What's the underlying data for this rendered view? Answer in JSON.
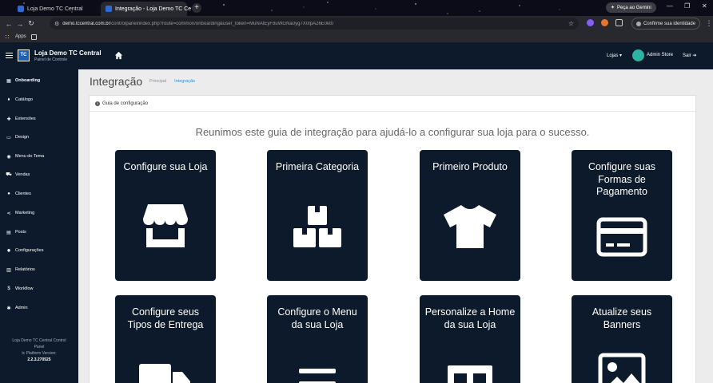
{
  "browser": {
    "tabs": [
      {
        "title": "Loja Demo TC Central",
        "close": "×"
      },
      {
        "title": "Integração - Loja Demo TC Ce",
        "close": "×"
      }
    ],
    "new_tab": "+",
    "gemini_label": "Peça ao Gemini",
    "url_host": "demo.tccentral.com.br",
    "url_path": "/controlpanel/index.php?route=common/onboarding&user_token=MuNAtEyF8uWGNa0yg7X0IpA26E0kt0",
    "identity_label": "Confirme sua identidade",
    "bookmark_apps": "Apps",
    "window_controls": [
      "—",
      "❐",
      "✕"
    ]
  },
  "header": {
    "brand_title": "Loja Demo TC Central",
    "brand_sub": "Painel de Controle",
    "logo_text": "TC",
    "store_menu": "Lojas ▾",
    "admin_name": "Admin Store",
    "logout": "Sair ➔"
  },
  "sidebar": {
    "items": [
      {
        "label": "Onboarding",
        "icon": "dashboard-icon",
        "glyph": "▦"
      },
      {
        "label": "Catálogo",
        "icon": "tag-icon",
        "glyph": "⬧"
      },
      {
        "label": "Extensões",
        "icon": "puzzle-icon",
        "glyph": "✚"
      },
      {
        "label": "Design",
        "icon": "monitor-icon",
        "glyph": "▭"
      },
      {
        "label": "Menu do Tema",
        "icon": "palette-icon",
        "glyph": "◉"
      },
      {
        "label": "Vendas",
        "icon": "cart-icon",
        "glyph": "⛟"
      },
      {
        "label": "Clientes",
        "icon": "user-icon",
        "glyph": "●"
      },
      {
        "label": "Marketing",
        "icon": "share-icon",
        "glyph": "⋖"
      },
      {
        "label": "Posts",
        "icon": "book-icon",
        "glyph": "▤"
      },
      {
        "label": "Configurações",
        "icon": "gear-icon",
        "glyph": "✹"
      },
      {
        "label": "Relatórios",
        "icon": "chart-icon",
        "glyph": "▥"
      },
      {
        "label": "Workflow",
        "icon": "dollar-icon",
        "glyph": "$"
      },
      {
        "label": "Admin",
        "icon": "asterisk-icon",
        "glyph": "✱"
      }
    ],
    "footer_line1": "Loja Demo TC Central Control",
    "footer_line2": "Panel",
    "footer_line3": "tc Platform Version:",
    "footer_version": "2.2.3.270525"
  },
  "main": {
    "page_title": "Integração",
    "breadcrumb": [
      "Principal",
      "Integração"
    ],
    "panel_title": "Guia de configuração",
    "intro": "Reunimos este guia de integração para ajudá-lo a configurar sua loja para o sucesso.",
    "cards": [
      {
        "title": "Configure sua Loja",
        "icon": "store-icon"
      },
      {
        "title": "Primeira Categoria",
        "icon": "boxes-icon"
      },
      {
        "title": "Primeiro Produto",
        "icon": "tshirt-icon"
      },
      {
        "title": "Configure suas Formas de Pagamento",
        "icon": "credit-card-icon"
      },
      {
        "title": "Configure seus Tipos de Entrega",
        "icon": "truck-icon"
      },
      {
        "title": "Configure o Menu da sua Loja",
        "icon": "menu-icon"
      },
      {
        "title": "Personalize a Home da sua Loja",
        "icon": "layout-icon"
      },
      {
        "title": "Atualize seus Banners",
        "icon": "image-icon"
      }
    ]
  },
  "colors": {
    "navy": "#0d1a2b",
    "accent_blue": "#2b8fd9",
    "avatar_teal": "#2bb3a3"
  }
}
